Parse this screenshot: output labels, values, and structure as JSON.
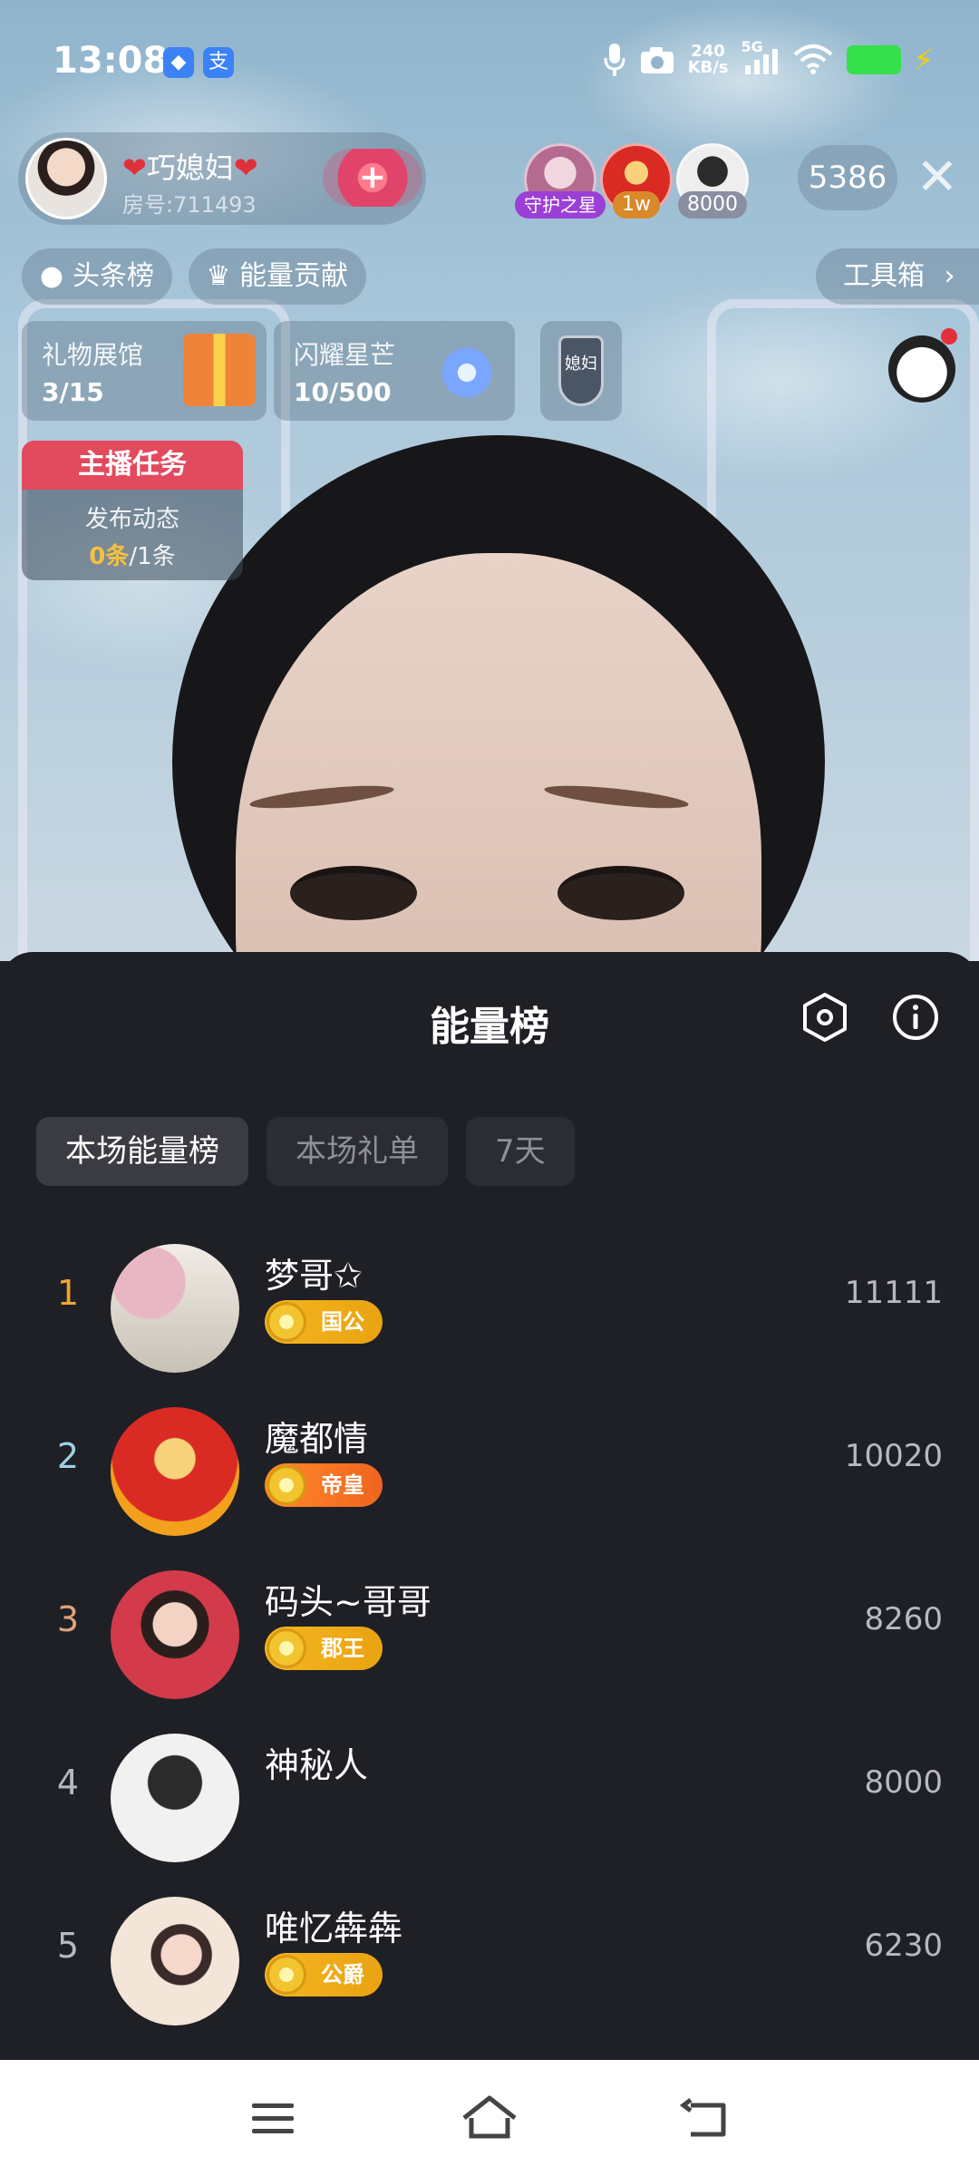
{
  "status_bar": {
    "time": "13:08",
    "net_speed_value": "240",
    "net_speed_unit": "KB/s",
    "network": "5G",
    "icons": [
      "app-notification-icon",
      "alipay-icon",
      "mic-icon",
      "camera-icon",
      "signal-icon",
      "wifi-icon",
      "battery-icon",
      "charging-icon"
    ],
    "alipay_glyph": "支"
  },
  "host": {
    "name": "巧媳妇",
    "heart": "❤",
    "room_id": "房号:711493",
    "follow_label": "+"
  },
  "top_fans": [
    {
      "badge": "守护之星",
      "badge_color": "#9b3fd6"
    },
    {
      "badge": "1w",
      "badge_color": "#d9892a"
    },
    {
      "badge": "8000",
      "badge_color": "#8a8fa0"
    }
  ],
  "viewer_count": "5386",
  "quick_pills": [
    {
      "icon": "flame-icon",
      "glyph": "●",
      "label": "头条榜"
    },
    {
      "icon": "crown-icon",
      "glyph": "♛",
      "label": "能量贡献"
    }
  ],
  "toolbox": {
    "label": "工具箱",
    "chevron": "›"
  },
  "tiles": [
    {
      "title": "礼物展馆",
      "value": "3/15"
    },
    {
      "title": "闪耀星芒",
      "value": "10/500"
    }
  ],
  "shield_text": "媳妇",
  "task": {
    "header": "主播任务",
    "line1": "发布动态",
    "done": "0条",
    "total": "/1条"
  },
  "sheet": {
    "title": "能量榜",
    "tabs": [
      "本场能量榜",
      "本场礼单",
      "7天"
    ],
    "active_tab": 0
  },
  "ranking": [
    {
      "rank": "1",
      "rank_color": "#f0a534",
      "name": "梦哥✩",
      "badge": "国公",
      "badge_style": "gold",
      "score": "11111"
    },
    {
      "rank": "2",
      "rank_color": "#9fd0e6",
      "name": "魔都情",
      "badge": "帝皇",
      "badge_style": "orange",
      "score": "10020"
    },
    {
      "rank": "3",
      "rank_color": "#e0a37c",
      "name": "码头~哥哥",
      "badge": "郡王",
      "badge_style": "gold",
      "score": "8260"
    },
    {
      "rank": "4",
      "rank_color": "#b7b8c0",
      "name": "神秘人",
      "badge": "",
      "badge_style": "none",
      "score": "8000"
    },
    {
      "rank": "5",
      "rank_color": "#b7b8c0",
      "name": "唯忆犇犇",
      "badge": "公爵",
      "badge_style": "gold",
      "score": "6230"
    }
  ],
  "nav_bar": {
    "icons": [
      "menu-icon",
      "home-icon",
      "back-icon"
    ]
  }
}
